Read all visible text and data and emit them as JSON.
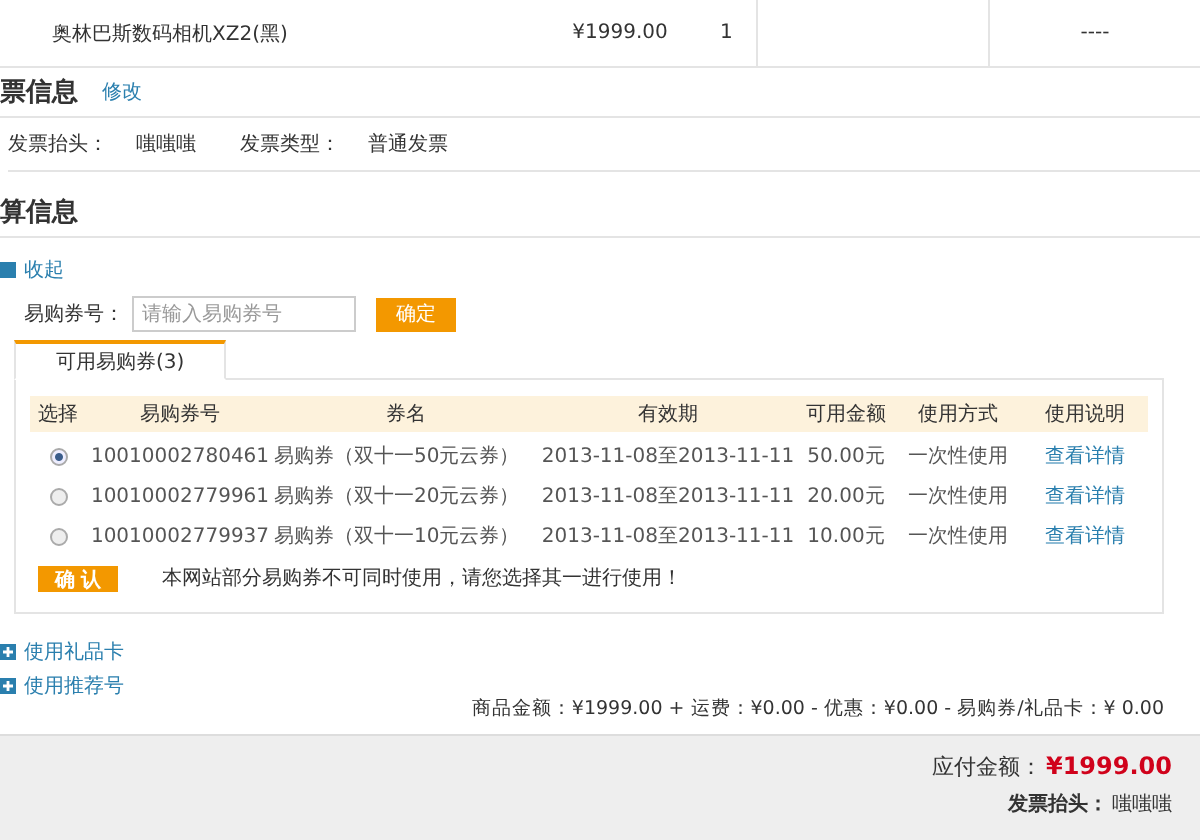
{
  "product_row": {
    "name": "奥林巴斯数码相机XZ2(黑)",
    "price": "¥1999.00",
    "qty": "1",
    "column_5": "----"
  },
  "invoice": {
    "title": "票信息",
    "edit": "修改",
    "fields": [
      {
        "label": "发票抬头：",
        "value": "嗤嗤嗤"
      },
      {
        "label": "发票类型：",
        "value": "普通发票"
      }
    ]
  },
  "settlement": {
    "title": "算信息",
    "collapse": "收起",
    "coupon_label": "易购券号：",
    "coupon_placeholder": "请输入易购券号",
    "apply": "确定",
    "tabs": [
      {
        "label": "可用易购券(3)",
        "selected": true
      }
    ],
    "columns": [
      "选择",
      "易购券号",
      "券名",
      "有效期",
      "可用金额",
      "使用方式",
      "使用说明"
    ],
    "rows": [
      {
        "selected": true,
        "number": "10010002780461",
        "name": "易购券（双十一50元云券）",
        "validity": "2013-11-08至2013-11-11",
        "amount": "50.00元",
        "usage": "一次性使用",
        "details": "查看详情"
      },
      {
        "selected": false,
        "number": "10010002779961",
        "name": "易购券（双十一20元云券）",
        "validity": "2013-11-08至2013-11-11",
        "amount": "20.00元",
        "usage": "一次性使用",
        "details": "查看详情"
      },
      {
        "selected": false,
        "number": "10010002779937",
        "name": "易购券（双十一10元云券）",
        "validity": "2013-11-08至2013-11-11",
        "amount": "10.00元",
        "usage": "一次性使用",
        "details": "查看详情"
      }
    ],
    "confirm": "确 认",
    "notice": "本网站部分易购券不可同时使用，请您选择其一进行使用！",
    "extras": [
      {
        "label": "使用礼品卡",
        "expanded": false
      },
      {
        "label": "使用推荐号",
        "expanded": false
      }
    ],
    "summary": "商品金额：¥1999.00 + 运费：¥0.00 - 优惠：¥0.00 - 易购券/礼品卡：¥ 0.00"
  },
  "footer": {
    "total_label": "应付金额：",
    "total": "¥1999.00",
    "invoice_label": "发票抬头：",
    "invoice_value": "嗤嗤嗤"
  }
}
